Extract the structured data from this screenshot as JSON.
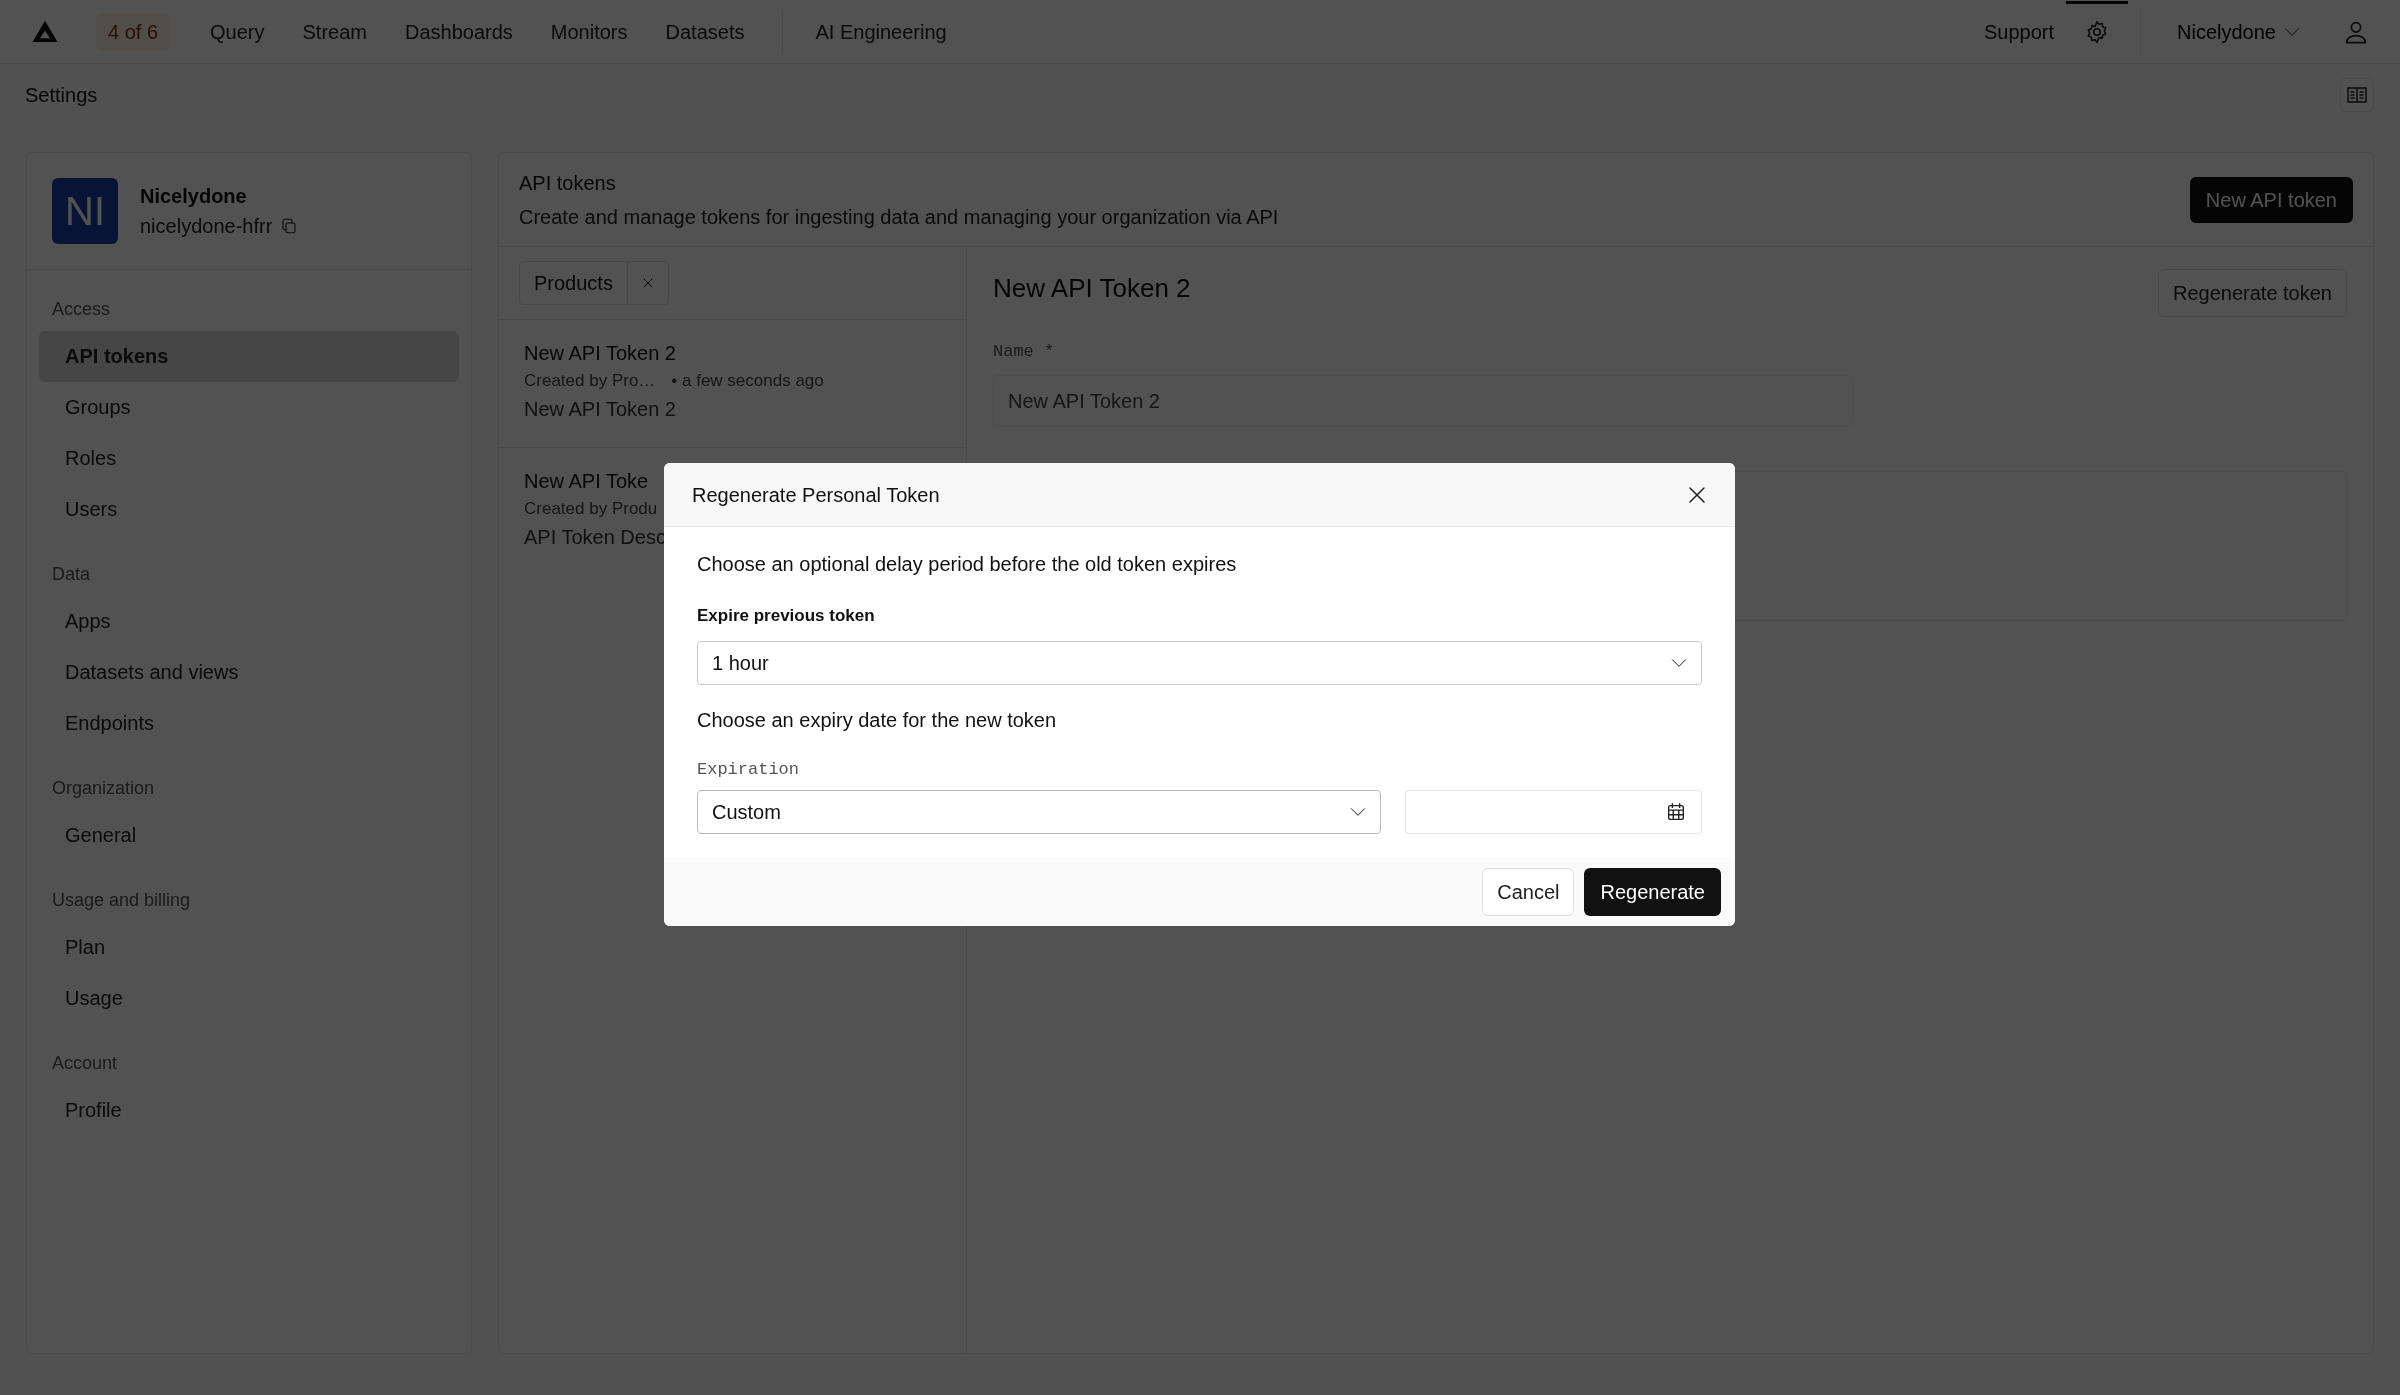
{
  "topbar": {
    "badge": "4 of 6",
    "nav": [
      {
        "label": "Query"
      },
      {
        "label": "Stream"
      },
      {
        "label": "Dashboards"
      },
      {
        "label": "Monitors"
      },
      {
        "label": "Datasets"
      }
    ],
    "extra_nav": "AI Engineering",
    "support": "Support",
    "settings": {
      "selected": true
    },
    "user": "Nicelydone"
  },
  "page_title": "Settings",
  "org": {
    "initials": "NI",
    "name": "Nicelydone",
    "slug": "nicelydone-hfrr"
  },
  "sidebar": {
    "sections": [
      {
        "title": "Access",
        "items": [
          {
            "label": "API tokens",
            "selected": true
          },
          {
            "label": "Groups",
            "selected": false
          },
          {
            "label": "Roles",
            "selected": false
          },
          {
            "label": "Users",
            "selected": false
          }
        ]
      },
      {
        "title": "Data",
        "items": [
          {
            "label": "Apps",
            "selected": false
          },
          {
            "label": "Datasets and views",
            "selected": false
          },
          {
            "label": "Endpoints",
            "selected": false
          }
        ]
      },
      {
        "title": "Organization",
        "items": [
          {
            "label": "General",
            "selected": false
          }
        ]
      },
      {
        "title": "Usage and billing",
        "items": [
          {
            "label": "Plan",
            "selected": false
          },
          {
            "label": "Usage",
            "selected": false
          }
        ]
      },
      {
        "title": "Account",
        "items": [
          {
            "label": "Profile",
            "selected": false
          }
        ]
      }
    ]
  },
  "panel": {
    "title": "API tokens",
    "subtitle": "Create and manage tokens for ingesting data and managing your organization via API",
    "new_button": "New API token"
  },
  "filter": {
    "label": "Products"
  },
  "tokens": [
    {
      "name": "New API Token 2",
      "creator": "Created by Pro…",
      "time": "• a few seconds ago",
      "description": "New API Token 2"
    },
    {
      "name": "New API Toke",
      "creator": "Created by Produ",
      "description": "API Token Desc"
    }
  ],
  "detail": {
    "title": "New API Token 2",
    "regenerate_button": "Regenerate token",
    "name_label": "Name *",
    "name_value": "New API Token 2"
  },
  "modal": {
    "title": "Regenerate Personal Token",
    "delay_text": "Choose an optional delay period before the old token expires",
    "expire_label": "Expire previous token",
    "expire_value": "1 hour",
    "expiry_text": "Choose an expiry date for the new token",
    "expiration_label": "Expiration",
    "expiration_value": "Custom",
    "cancel": "Cancel",
    "confirm": "Regenerate"
  }
}
